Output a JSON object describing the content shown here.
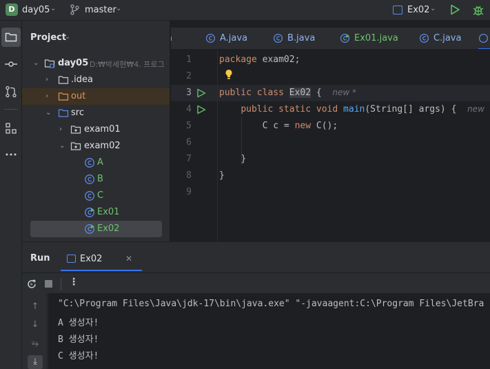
{
  "topbar": {
    "project_badge": "D",
    "project_name": "day05",
    "branch": "master",
    "run_config": "Ex02"
  },
  "project_panel": {
    "title": "Project",
    "tree": [
      {
        "label": "day05",
        "path": "D:₩박세현₩4. 프로그",
        "type": "module"
      },
      {
        "label": ".idea",
        "type": "folder"
      },
      {
        "label": "out",
        "type": "folder-excluded"
      },
      {
        "label": "src",
        "type": "source-folder"
      },
      {
        "label": "exam01",
        "type": "package"
      },
      {
        "label": "exam02",
        "type": "package"
      },
      {
        "label": "A",
        "type": "class"
      },
      {
        "label": "B",
        "type": "class"
      },
      {
        "label": "C",
        "type": "class"
      },
      {
        "label": "Ex01",
        "type": "main-class"
      },
      {
        "label": "Ex02",
        "type": "main-class"
      }
    ]
  },
  "tabs": [
    {
      "label": "a"
    },
    {
      "label": "A.java"
    },
    {
      "label": "B.java"
    },
    {
      "label": "Ex01.java"
    },
    {
      "label": "C.java"
    }
  ],
  "editor": {
    "line_numbers": [
      "1",
      "2",
      "3",
      "4",
      "5",
      "6",
      "7",
      "8",
      "9"
    ],
    "lines": {
      "l1_kw": "package",
      "l1_rest": " exam02;",
      "l3_kw1": "public",
      "l3_kw2": "class",
      "l3_cls": "Ex02",
      "l3_brace": " {",
      "l3_hint": "new *",
      "l4_kw1": "public",
      "l4_kw2": "static",
      "l4_kw3": "void",
      "l4_fn": "main",
      "l4_rest": "(String[] args) {",
      "l4_hint": "new",
      "l5_a": "C c = ",
      "l5_kw": "new",
      "l5_b": " C();",
      "l7": "}",
      "l8": "}"
    }
  },
  "run_panel": {
    "title": "Run",
    "tab_label": "Ex02",
    "tab_close": "✕",
    "more": "⋮",
    "console_lines": [
      "\"C:\\Program Files\\Java\\jdk-17\\bin\\java.exe\" \"-javaagent:C:\\Program Files\\JetBra",
      "A 생성자!",
      "B 생성자!",
      "C 생성자!"
    ]
  },
  "colors": {
    "accent": "#3574f0",
    "keyword": "#cf8e6d",
    "function": "#56a8f5",
    "run_green": "#5fb865"
  }
}
